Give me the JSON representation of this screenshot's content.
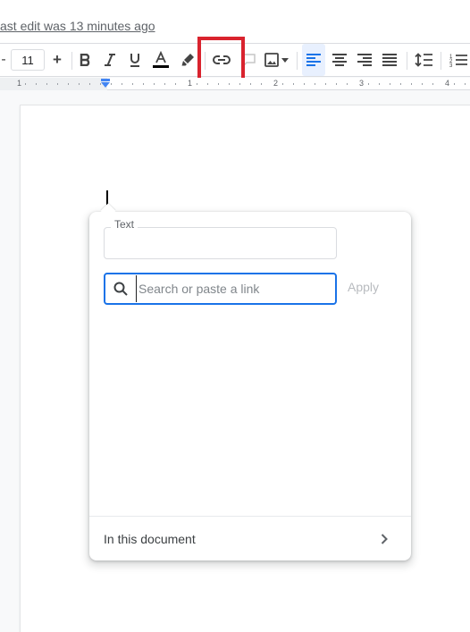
{
  "header": {
    "last_edit": "ast edit was 13 minutes ago"
  },
  "toolbar": {
    "font_size": "11",
    "decrease_font_label": "-",
    "increase_font_label": "+",
    "text_color": "#000000",
    "buttons": [
      "bold",
      "italic",
      "underline",
      "text-color",
      "highlight-color",
      "insert-link",
      "add-comment",
      "insert-image",
      "align-left",
      "align-center",
      "align-right",
      "align-justify",
      "line-spacing",
      "numbered-list"
    ],
    "active_alignment": "align-left",
    "highlight_box_color": "#d9232e"
  },
  "ruler": {
    "numbers": [
      "1",
      "1",
      "2",
      "3",
      "4"
    ]
  },
  "link_popup": {
    "text_label": "Text",
    "text_value": "",
    "search_placeholder": "Search or paste a link",
    "search_value": "",
    "apply_label": "Apply",
    "footer_label": "In this document"
  },
  "colors": {
    "accent": "#1a73e8",
    "apply_disabled": "#b8bbbf"
  }
}
